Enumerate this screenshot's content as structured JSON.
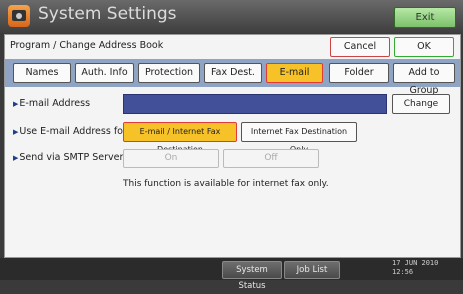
{
  "window": {
    "title": "System Settings",
    "exit_label": "Exit"
  },
  "header": {
    "label": "Program / Change Address Book",
    "cancel_label": "Cancel",
    "ok_label": "OK"
  },
  "tabs": [
    {
      "label": "Names",
      "active": false
    },
    {
      "label": "Auth. Info",
      "active": false
    },
    {
      "label": "Protection",
      "active": false
    },
    {
      "label": "Fax Dest.",
      "active": false
    },
    {
      "label": "E-mail",
      "active": true
    },
    {
      "label": "Folder",
      "active": false
    },
    {
      "label": "Add to Group",
      "active": false
    }
  ],
  "email": {
    "label": "E-mail Address",
    "value": "",
    "change_label": "Change"
  },
  "use_for": {
    "label": "Use E-mail Address for",
    "options": [
      {
        "label": "E-mail / Internet Fax Destination",
        "selected": true
      },
      {
        "label": "Internet Fax Destination Only",
        "selected": false
      }
    ]
  },
  "smtp": {
    "label": "Send via SMTP Server",
    "on_label": "On",
    "off_label": "Off",
    "note": "This function is available for internet fax only."
  },
  "statusbar": {
    "system_status_label": "System Status",
    "job_list_label": "Job List",
    "date": "17 JUN  2010",
    "time": "12:56"
  },
  "colors": {
    "accent": "#f7c227",
    "tabbar": "#8fa4c4",
    "field": "#42509a"
  }
}
